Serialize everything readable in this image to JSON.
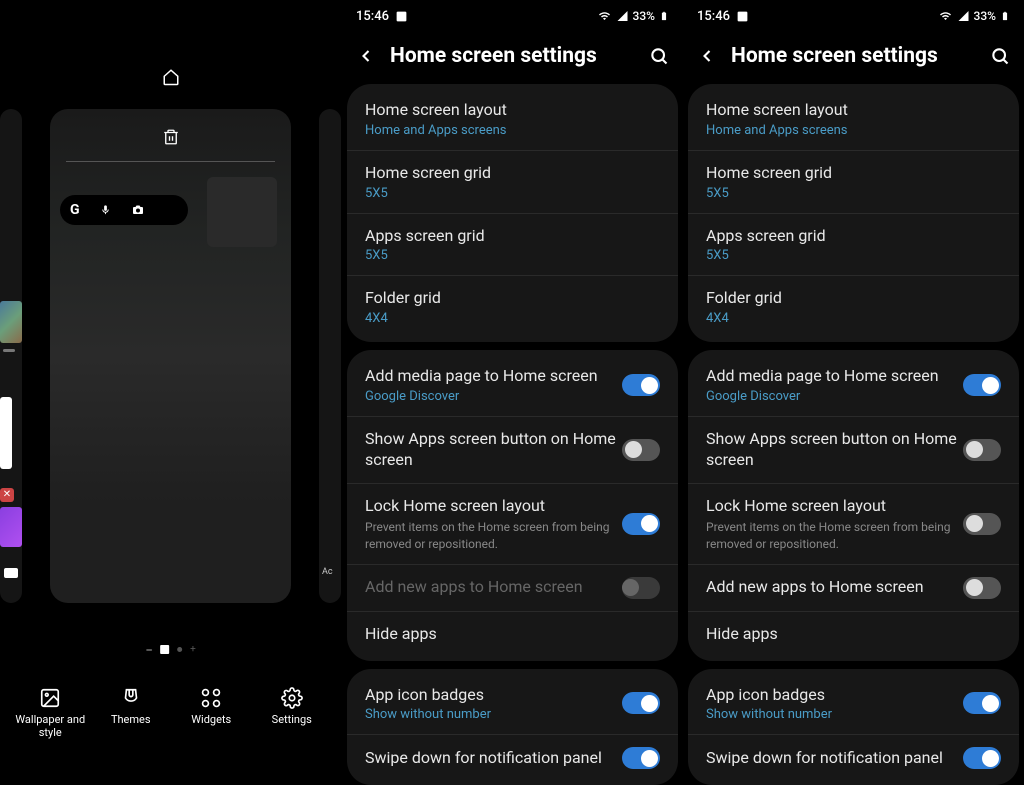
{
  "status": {
    "time": "15:46",
    "battery": "33%"
  },
  "header": {
    "title": "Home screen settings"
  },
  "editor": {
    "toolbar": [
      {
        "label": "Wallpaper and style"
      },
      {
        "label": "Themes"
      },
      {
        "label": "Widgets"
      },
      {
        "label": "Settings"
      }
    ],
    "google": "G",
    "partial": "Ac"
  },
  "settings": {
    "layout": {
      "title": "Home screen layout",
      "value": "Home and Apps screens"
    },
    "homeGrid": {
      "title": "Home screen grid",
      "value": "5X5"
    },
    "appsGrid": {
      "title": "Apps screen grid",
      "value": "5X5"
    },
    "folderGrid": {
      "title": "Folder grid",
      "value": "4X4"
    },
    "mediaPage": {
      "title": "Add media page to Home screen",
      "value": "Google Discover"
    },
    "appsButton": {
      "title": "Show Apps screen button on Home screen"
    },
    "lockLayout": {
      "title": "Lock Home screen layout",
      "desc": "Prevent items on the Home screen from being removed or repositioned."
    },
    "addNewApps": {
      "title": "Add new apps to Home screen"
    },
    "hideApps": {
      "title": "Hide apps"
    },
    "iconBadges": {
      "title": "App icon badges",
      "value": "Show without number"
    },
    "swipeDown": {
      "title": "Swipe down for notification panel"
    }
  },
  "panel2": {
    "lockLayoutOn": true,
    "addNewAppsDisabled": true,
    "addNewAppsOn": false
  },
  "panel3": {
    "lockLayoutOn": false,
    "addNewAppsDisabled": false,
    "addNewAppsOn": false
  }
}
